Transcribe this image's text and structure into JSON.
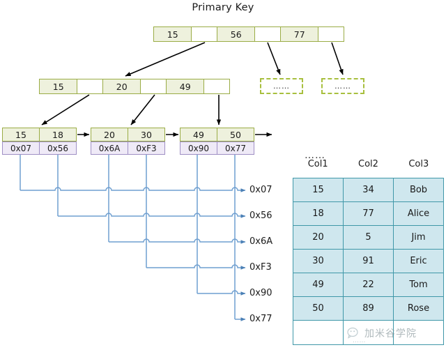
{
  "title": "Primary Key",
  "colors": {
    "node_fill": "#eef1dd",
    "node_border": "#9aac45",
    "pointer_fill": "#efeaf7",
    "pointer_border": "#9f8fc4",
    "wire": "#6f9fd0",
    "arrow": "#000000",
    "table_fill": "#cfe7ee",
    "table_border": "#3f97a8",
    "dashed_border": "#a8bf3e"
  },
  "tree": {
    "root": {
      "name": "root-node",
      "cells": [
        {
          "label": "15",
          "blank": false
        },
        {
          "label": "",
          "blank": true
        },
        {
          "label": "56",
          "blank": false
        },
        {
          "label": "",
          "blank": true
        },
        {
          "label": "77",
          "blank": false
        },
        {
          "label": "",
          "blank": true
        }
      ]
    },
    "internal": {
      "name": "internal-node",
      "cells": [
        {
          "label": "15",
          "blank": false
        },
        {
          "label": "",
          "blank": true
        },
        {
          "label": "20",
          "blank": false
        },
        {
          "label": "",
          "blank": true
        },
        {
          "label": "49",
          "blank": false
        },
        {
          "label": "",
          "blank": true
        }
      ]
    },
    "leaves": [
      {
        "name": "leaf-node-1",
        "keys": [
          "15",
          "18"
        ],
        "pointers": [
          "0x07",
          "0x56"
        ]
      },
      {
        "name": "leaf-node-2",
        "keys": [
          "20",
          "30"
        ],
        "pointers": [
          "0x6A",
          "0xF3"
        ]
      },
      {
        "name": "leaf-node-3",
        "keys": [
          "49",
          "50"
        ],
        "pointers": [
          "0x90",
          "0x77"
        ]
      }
    ],
    "placeholders": [
      {
        "name": "placeholder-subtree-1",
        "label": "……"
      },
      {
        "name": "placeholder-subtree-2",
        "label": "……"
      }
    ]
  },
  "addresses": [
    {
      "label": "0x07"
    },
    {
      "label": "0x56"
    },
    {
      "label": "0x6A"
    },
    {
      "label": "0xF3"
    },
    {
      "label": "0x90"
    },
    {
      "label": "0x77"
    }
  ],
  "right_ellipsis": "……",
  "table": {
    "headers": [
      "Col1",
      "Col2",
      "Col3"
    ],
    "rows": [
      [
        "15",
        "34",
        "Bob"
      ],
      [
        "18",
        "77",
        "Alice"
      ],
      [
        "20",
        "5",
        "Jim"
      ],
      [
        "30",
        "91",
        "Eric"
      ],
      [
        "49",
        "22",
        "Tom"
      ],
      [
        "50",
        "89",
        "Rose"
      ]
    ],
    "trailing_row": [
      "",
      "",
      ""
    ]
  },
  "watermark": {
    "text": "加米谷学院",
    "dots": "……"
  }
}
